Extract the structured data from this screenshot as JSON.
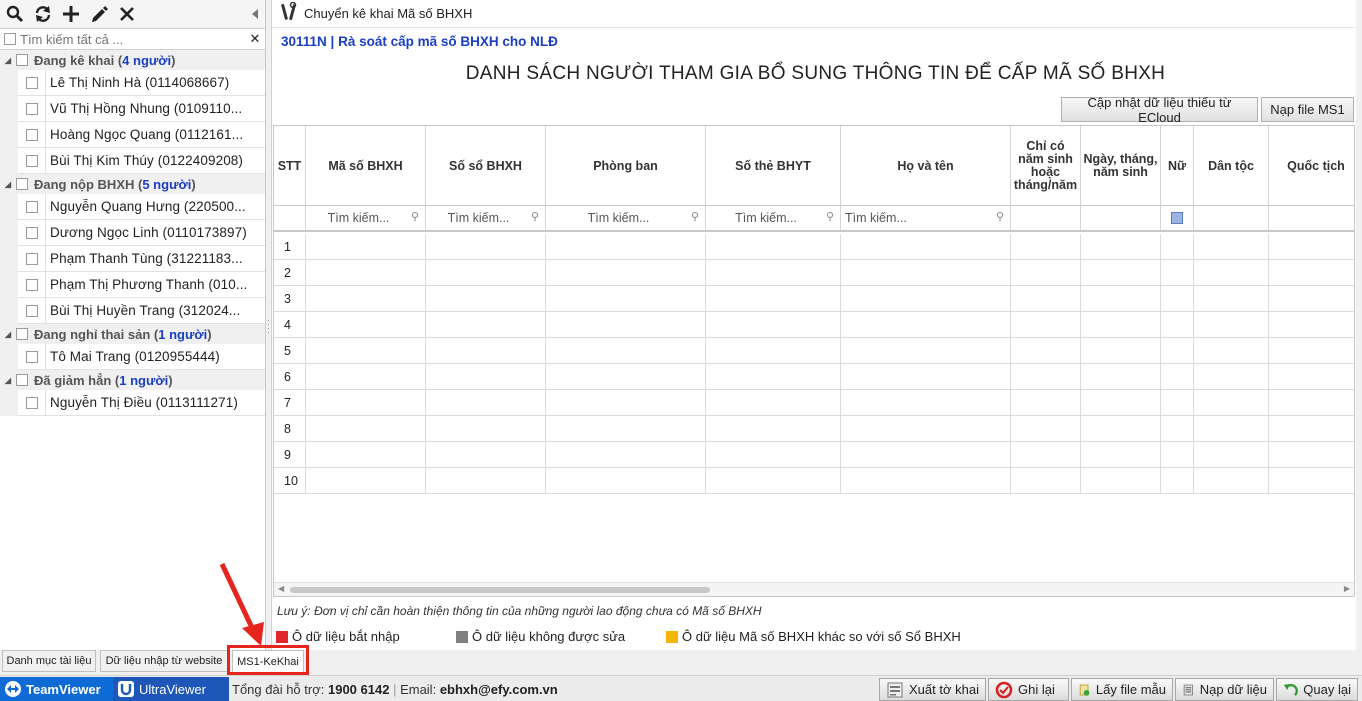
{
  "left_panel": {
    "search_placeholder": "Tìm kiếm tất cả ...",
    "groups": [
      {
        "name": "Đang kê khai",
        "count": "4 người",
        "items": [
          "Lê Thị Ninh Hà (0114068667)",
          "Vũ Thị Hồng Nhung (0109110...",
          "Hoàng Ngọc Quang (0112161...",
          "Bùi Thị Kim Thúy (0122409208)"
        ]
      },
      {
        "name": "Đang nộp BHXH",
        "count": "5 người",
        "items": [
          "Nguyễn Quang Hưng (220500...",
          "Dương Ngọc Linh (0110173897)",
          "Phạm Thanh Tùng (31221183...",
          "Phạm Thị Phương Thanh (010...",
          "Bùi Thị Huyền Trang (312024..."
        ]
      },
      {
        "name": "Đang nghỉ thai sản",
        "count": "1 người",
        "items": [
          "Tô Mai Trang (0120955444)"
        ]
      },
      {
        "name": "Đã giảm hẳn",
        "count": "1 người",
        "items": [
          "Nguyễn Thị Điều (0113111271)"
        ]
      }
    ]
  },
  "main": {
    "header_title": "Chuyển kê khai Mã số BHXH",
    "doc_code": "30111N | Rà soát cấp mã số BHXH cho NLĐ",
    "doc_title": "DANH SÁCH NGƯỜI THAM GIA BỔ SUNG THÔNG TIN ĐỂ CẤP MÃ SỐ BHXH",
    "buttons": {
      "update_ecloud": "Cập nhật dữ liệu thiếu từ ECloud",
      "load_ms1": "Nạp file MS1"
    },
    "columns": [
      "STT",
      "Mã số BHXH",
      "Số sổ BHXH",
      "Phòng ban",
      "Số thẻ BHYT",
      "Họ và tên",
      "Chỉ có năm sinh hoặc tháng/năm",
      "Ngày, tháng, năm sinh",
      "Nữ",
      "Dân tộc",
      "Quốc tịch"
    ],
    "filter_placeholder": "Tìm kiếm...",
    "row_numbers": [
      "1",
      "2",
      "3",
      "4",
      "5",
      "6",
      "7",
      "8",
      "9",
      "10"
    ],
    "note": "Lưu ý: Đơn vị chỉ cần hoàn thiện thông tin của những người lao động chưa có Mã số BHXH",
    "legend": [
      {
        "label": "Ô dữ liệu bắt nhập",
        "color": "#e0262c"
      },
      {
        "label": "Ô dữ liệu không được sửa",
        "color": "#808080"
      },
      {
        "label": "Ô dữ liệu Mã số BHXH khác so với số Sổ BHXH",
        "color": "#f5b400"
      }
    ]
  },
  "bottom_tabs": [
    "Danh mục tài liệu",
    "Dữ liệu nhập từ website",
    "MS1-KeKhai"
  ],
  "status_bar": {
    "teamviewer": "TeamViewer",
    "ultraviewer": "UltraViewer",
    "support_label": "Tổng đài hỗ trợ:",
    "support_phone": "1900 6142",
    "email_label": "Email:",
    "email": "ebhxh@efy.com.vn",
    "buttons": [
      "Xuất tờ khai",
      "Ghi lại",
      "Lấy file mẫu",
      "Nạp dữ liệu",
      "Quay lại"
    ]
  }
}
